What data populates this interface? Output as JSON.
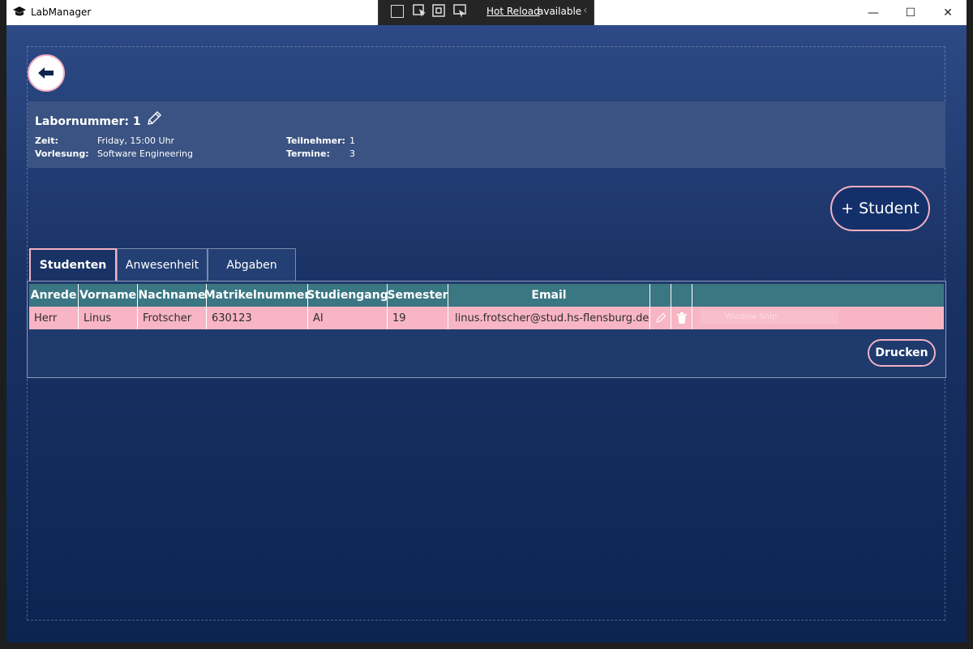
{
  "window": {
    "title": "LabManager",
    "controls": {
      "minimize": "—",
      "maximize": "☐",
      "close": "✕"
    }
  },
  "hot_reload": {
    "link": "Hot Reload",
    "text": "available",
    "chevron": "‹"
  },
  "lab": {
    "title": "Labornummer: 1",
    "zeit_label": "Zeit:",
    "zeit_value": "Friday, 15:00 Uhr",
    "vorlesung_label": "Vorlesung:",
    "vorlesung_value": "Software Engineering",
    "teilnehmer_label": "Teilnehmer:",
    "teilnehmer_value": "1",
    "termine_label": "Termine:",
    "termine_value": "3"
  },
  "buttons": {
    "add_student": "+ Student",
    "drucken": "Drucken"
  },
  "tabs": [
    {
      "label": "Studenten",
      "active": true
    },
    {
      "label": "Anwesenheit",
      "active": false
    },
    {
      "label": "Abgaben",
      "active": false
    }
  ],
  "table": {
    "columns": [
      "Anrede",
      "Vorname",
      "Nachname",
      "Matrikelnummer",
      "Studiengang",
      "Semester",
      "Email",
      "",
      ""
    ],
    "rows": [
      {
        "anrede": "Herr",
        "vorname": "Linus",
        "nachname": "Frotscher",
        "matrikelnummer": "630123",
        "studiengang": "AI",
        "semester": "19",
        "email": "linus.frotscher@stud.hs-flensburg.de"
      }
    ]
  },
  "overlay": {
    "window_snip": "Window Snip"
  },
  "colors": {
    "accent_pink": "#f3b0c3",
    "header_teal": "#3b7683",
    "row_pink": "#f8b5c3",
    "background_navy": "#0b2450"
  },
  "icons": [
    "app-icon",
    "back-arrow-icon",
    "pencil-icon",
    "edit-icon",
    "trash-icon"
  ]
}
